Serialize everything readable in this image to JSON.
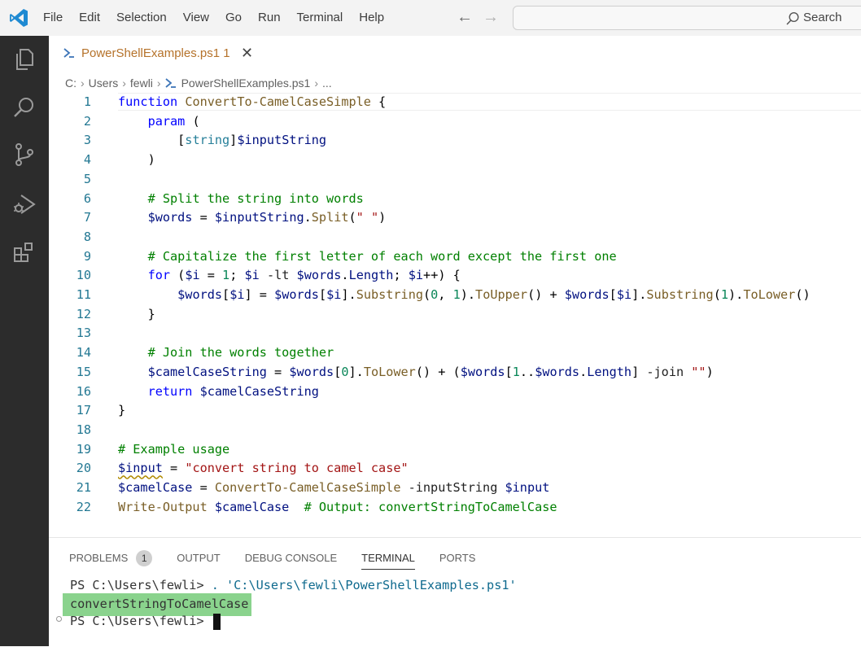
{
  "menu": [
    "File",
    "Edit",
    "Selection",
    "View",
    "Go",
    "Run",
    "Terminal",
    "Help"
  ],
  "search": {
    "label": "Search"
  },
  "tab": {
    "name": "PowerShellExamples.ps1",
    "problem_count": "1"
  },
  "breadcrumb": {
    "drive": "C:",
    "folder1": "Users",
    "folder2": "fewli",
    "file": "PowerShellExamples.ps1",
    "more": "..."
  },
  "editor": {
    "lines": [
      {
        "n": "1"
      },
      {
        "n": "2"
      },
      {
        "n": "3"
      },
      {
        "n": "4"
      },
      {
        "n": "5"
      },
      {
        "n": "6"
      },
      {
        "n": "7"
      },
      {
        "n": "8"
      },
      {
        "n": "9"
      },
      {
        "n": "10"
      },
      {
        "n": "11"
      },
      {
        "n": "12"
      },
      {
        "n": "13"
      },
      {
        "n": "14"
      },
      {
        "n": "15"
      },
      {
        "n": "16"
      },
      {
        "n": "17"
      },
      {
        "n": "18"
      },
      {
        "n": "19"
      },
      {
        "n": "20"
      },
      {
        "n": "21"
      },
      {
        "n": "22"
      }
    ],
    "code": [
      "function ConvertTo-CamelCaseSimple {",
      "    param (",
      "        [string]$inputString",
      "    )",
      "",
      "    # Split the string into words",
      "    $words = $inputString.Split(\" \")",
      "",
      "    # Capitalize the first letter of each word except the first one",
      "    for ($i = 1; $i -lt $words.Length; $i++) {",
      "        $words[$i] = $words[$i].Substring(0, 1).ToUpper() + $words[$i].Substring(1).ToLower()",
      "    }",
      "",
      "    # Join the words together",
      "    $camelCaseString = $words[0].ToLower() + ($words[1..$words.Length] -join \"\")",
      "    return $camelCaseString",
      "}",
      "",
      "# Example usage",
      "$input = \"convert string to camel case\"",
      "$camelCase = ConvertTo-CamelCaseSimple -inputString $input",
      "Write-Output $camelCase  # Output: convertStringToCamelCase"
    ]
  },
  "panel": {
    "tabs": [
      "PROBLEMS",
      "OUTPUT",
      "DEBUG CONSOLE",
      "TERMINAL",
      "PORTS"
    ],
    "problems_count": "1",
    "active_tab": "TERMINAL"
  },
  "terminal": {
    "prompt1": "PS C:\\Users\\fewli> ",
    "command": ". 'C:\\Users\\fewli\\PowerShellExamples.ps1'",
    "output": "convertStringToCamelCase",
    "prompt2": "PS C:\\Users\\fewli> "
  },
  "colors": {
    "activity_bar": "#2c2c2c",
    "title_bar": "#f3f3f3",
    "highlight": "#8ad38d",
    "keyword": "#0000ff",
    "comment": "#008000",
    "string": "#a31515"
  },
  "icons": [
    "vscode-logo-icon",
    "explorer-icon",
    "search-icon",
    "source-control-icon",
    "run-debug-icon",
    "extensions-icon",
    "powershell-file-icon",
    "close-icon",
    "back-arrow-icon",
    "forward-arrow-icon"
  ]
}
